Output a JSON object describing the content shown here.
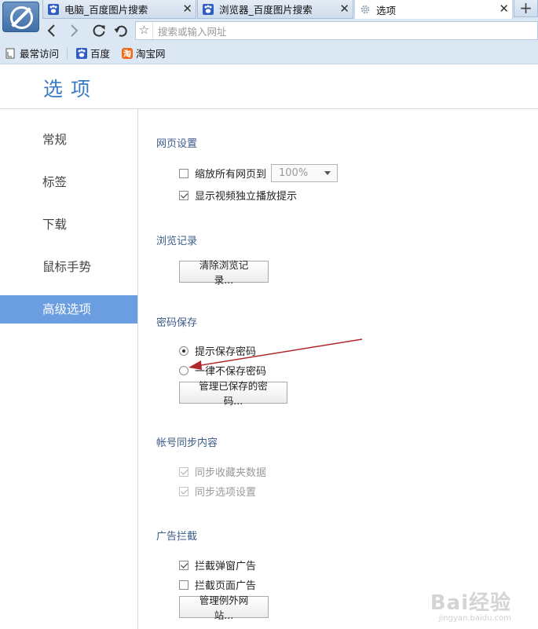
{
  "tabs": [
    {
      "title": "电脑_百度图片搜索",
      "icon": "baidu-paw-icon",
      "close": "✕"
    },
    {
      "title": "浏览器_百度图片搜索",
      "icon": "baidu-paw-icon",
      "close": "✕"
    },
    {
      "title": "选项",
      "icon": "gear-icon",
      "close": "✕",
      "active": true
    }
  ],
  "new_tab_label": "+",
  "address_bar": {
    "placeholder": "搜索或输入网址"
  },
  "bookmarks": [
    {
      "label": "最常访问",
      "icon": "document-icon"
    },
    {
      "label": "百度",
      "icon": "baidu-paw-icon"
    },
    {
      "label": "淘宝网",
      "icon": "taobao-icon"
    }
  ],
  "page": {
    "title": "选项"
  },
  "sidebar": {
    "items": [
      {
        "label": "常规"
      },
      {
        "label": "标签"
      },
      {
        "label": "下载"
      },
      {
        "label": "鼠标手势"
      },
      {
        "label": "高级选项",
        "active": true
      }
    ]
  },
  "sections": {
    "webpage": {
      "title": "网页设置",
      "zoom": {
        "label": "缩放所有网页到",
        "checked": false,
        "value": "100%"
      },
      "video": {
        "label": "显示视频独立播放提示",
        "checked": true
      }
    },
    "history": {
      "title": "浏览记录",
      "clear_button": "清除浏览记录..."
    },
    "password": {
      "title": "密码保存",
      "option_prompt": {
        "label": "提示保存密码",
        "selected": true
      },
      "option_never": {
        "label": "一律不保存密码",
        "selected": false
      },
      "manage_button": "管理已保存的密码..."
    },
    "sync": {
      "title": "帐号同步内容",
      "favorites": {
        "label": "同步收藏夹数据",
        "checked": true,
        "disabled": true
      },
      "options": {
        "label": "同步选项设置",
        "checked": true,
        "disabled": true
      }
    },
    "adblock": {
      "title": "广告拦截",
      "popup": {
        "label": "拦截弹窗广告",
        "checked": true
      },
      "page": {
        "label": "拦截页面广告",
        "checked": false
      },
      "manage_button": "管理例外网站..."
    }
  },
  "annotation_arrow_color": "#b0282e",
  "accent_color": "#6a9ee0",
  "watermark": {
    "main": "Bai经验",
    "sub": "jingyan.baidu.com"
  }
}
